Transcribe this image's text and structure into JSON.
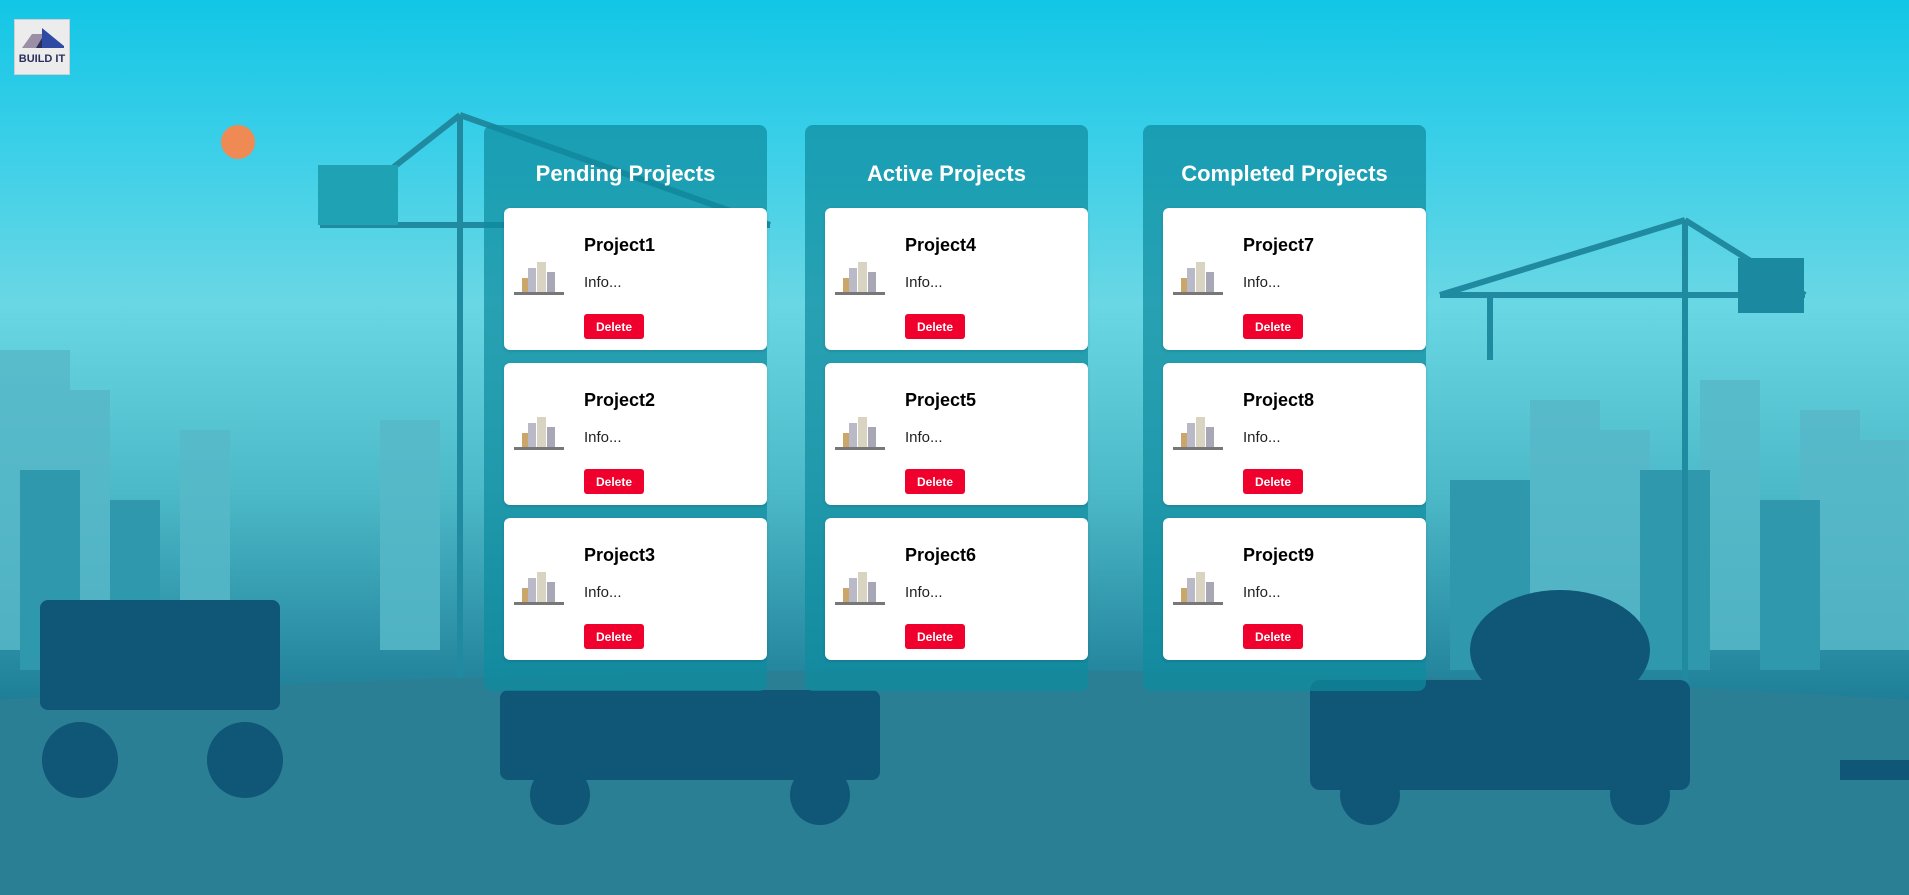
{
  "app": {
    "logo_text": "BUILD IT"
  },
  "columns": [
    {
      "title": "Pending Projects",
      "cards": [
        {
          "title": "Project1",
          "info": "Info...",
          "delete_label": "Delete"
        },
        {
          "title": "Project2",
          "info": "Info...",
          "delete_label": "Delete"
        },
        {
          "title": "Project3",
          "info": "Info...",
          "delete_label": "Delete"
        }
      ]
    },
    {
      "title": "Active Projects",
      "cards": [
        {
          "title": "Project4",
          "info": "Info...",
          "delete_label": "Delete"
        },
        {
          "title": "Project5",
          "info": "Info...",
          "delete_label": "Delete"
        },
        {
          "title": "Project6",
          "info": "Info...",
          "delete_label": "Delete"
        }
      ]
    },
    {
      "title": "Completed Projects",
      "cards": [
        {
          "title": "Project7",
          "info": "Info...",
          "delete_label": "Delete"
        },
        {
          "title": "Project8",
          "info": "Info...",
          "delete_label": "Delete"
        },
        {
          "title": "Project9",
          "info": "Info...",
          "delete_label": "Delete"
        }
      ]
    }
  ],
  "colors": {
    "panel": "#0e8ca0",
    "card": "#ffffff",
    "delete_button": "#f0002c",
    "logo_dark": "#2a2f5c"
  },
  "icons": {
    "logo": "building-logo-icon",
    "card_thumb": "city-buildings-icon"
  }
}
